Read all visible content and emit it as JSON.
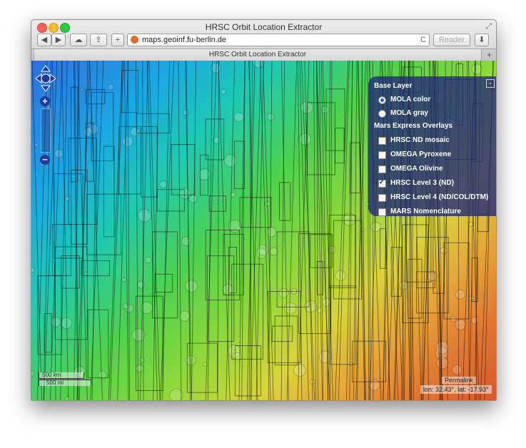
{
  "window": {
    "title": "HRSC Orbit Location Extractor"
  },
  "toolbar": {
    "back_label": "◀",
    "forward_label": "▶",
    "cloud_label": "☁",
    "share_label": "⇪",
    "add_label": "+",
    "url": "maps.geoinf.fu-berlin.de",
    "reload_label": "C",
    "reader_label": "Reader",
    "downloads_label": "⬇"
  },
  "tabs": [
    {
      "label": "HRSC Orbit Location Extractor"
    }
  ],
  "tab_add_label": "+",
  "layer_switcher": {
    "toggle_label": "-",
    "base_heading": "Base Layer",
    "base_layers": [
      {
        "label": "MOLA color",
        "selected": true
      },
      {
        "label": "MOLA gray",
        "selected": false
      }
    ],
    "overlay_heading": "Mars Express Overlays",
    "overlays": [
      {
        "label": "HRSC ND mosaic",
        "checked": false
      },
      {
        "label": "OMEGA Pyroxene",
        "checked": false
      },
      {
        "label": "OMEGA Olivine",
        "checked": false
      },
      {
        "label": "HRSC Level 3 (ND)",
        "checked": true
      },
      {
        "label": "HRSC Level 4 (ND/COL/DTM)",
        "checked": false
      },
      {
        "label": "MARS Nomenclature",
        "checked": false
      }
    ]
  },
  "map": {
    "zoom_in_label": "+",
    "zoom_out_label": "−",
    "scale_top": "500 km",
    "scale_bottom": "500 mi",
    "permalink": "Permalink",
    "mouse_position": "lon: 32.43°, lat: -17.93°"
  },
  "colors": {
    "layer_panel": "#20267a",
    "zoom_controls": "#1f3a9c"
  }
}
